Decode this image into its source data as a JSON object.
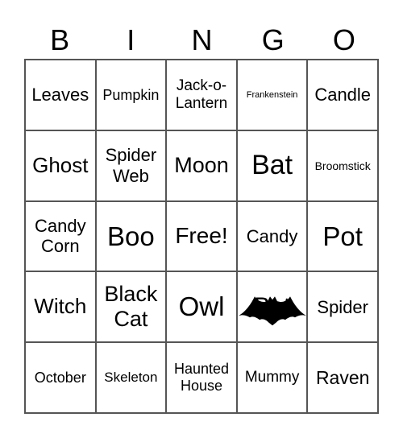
{
  "header": [
    "B",
    "I",
    "N",
    "G",
    "O"
  ],
  "cells": [
    {
      "text": "Leaves",
      "size": 22
    },
    {
      "text": "Pumpkin",
      "size": 18
    },
    {
      "text": "Jack-o-Lantern",
      "size": 19
    },
    {
      "text": "Frankenstein",
      "size": 11
    },
    {
      "text": "Candle",
      "size": 22
    },
    {
      "text": "Ghost",
      "size": 26
    },
    {
      "text": "Spider Web",
      "size": 22
    },
    {
      "text": "Moon",
      "size": 27
    },
    {
      "text": "Bat",
      "size": 34
    },
    {
      "text": "Broomstick",
      "size": 14
    },
    {
      "text": "Candy Corn",
      "size": 22
    },
    {
      "text": "Boo",
      "size": 33
    },
    {
      "text": "Free!",
      "size": 28
    },
    {
      "text": "Candy",
      "size": 22
    },
    {
      "text": "Pot",
      "size": 33
    },
    {
      "text": "Witch",
      "size": 26
    },
    {
      "text": "Black Cat",
      "size": 27
    },
    {
      "text": "Owl",
      "size": 33
    },
    {
      "text": "Bat",
      "size": 30,
      "image": "bat-icon"
    },
    {
      "text": "Spider",
      "size": 22
    },
    {
      "text": "October",
      "size": 18
    },
    {
      "text": "Skeleton",
      "size": 17
    },
    {
      "text": "Haunted House",
      "size": 18
    },
    {
      "text": "Mummy",
      "size": 19
    },
    {
      "text": "Raven",
      "size": 23
    }
  ]
}
